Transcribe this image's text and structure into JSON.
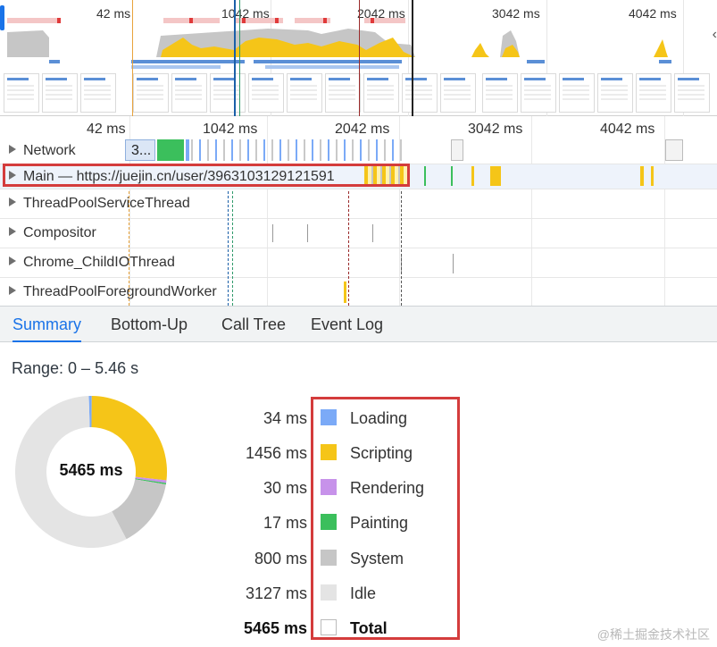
{
  "overview": {
    "ticks": [
      "42 ms",
      "1042 ms",
      "2042 ms",
      "3042 ms",
      "4042 ms"
    ],
    "right_handle_icon": "chevron-left-icon"
  },
  "timeline": {
    "ticks": [
      "42 ms",
      "1042 ms",
      "2042 ms",
      "3042 ms",
      "4042 ms"
    ],
    "network_block_label": "3...",
    "tracks": [
      {
        "label": "Network"
      },
      {
        "label": "Main — https://juejin.cn/user/3963103129121591"
      },
      {
        "label": "ThreadPoolServiceThread"
      },
      {
        "label": "Compositor"
      },
      {
        "label": "Chrome_ChildIOThread"
      },
      {
        "label": "ThreadPoolForegroundWorker"
      }
    ]
  },
  "tabs": [
    {
      "label": "Summary",
      "active": true
    },
    {
      "label": "Bottom-Up",
      "active": false
    },
    {
      "label": "Call Tree",
      "active": false
    },
    {
      "label": "Event Log",
      "active": false
    }
  ],
  "summary": {
    "range": "Range: 0 – 5.46 s",
    "total_label": "5465 ms",
    "categories": [
      {
        "value": "34 ms",
        "name": "Loading",
        "ms": 34,
        "color": "#7baaf7"
      },
      {
        "value": "1456 ms",
        "name": "Scripting",
        "ms": 1456,
        "color": "#f5c518"
      },
      {
        "value": "30 ms",
        "name": "Rendering",
        "ms": 30,
        "color": "#c792ea"
      },
      {
        "value": "17 ms",
        "name": "Painting",
        "ms": 17,
        "color": "#3bbf5c"
      },
      {
        "value": "800 ms",
        "name": "System",
        "ms": 800,
        "color": "#c6c6c6"
      },
      {
        "value": "3127 ms",
        "name": "Idle",
        "ms": 3127,
        "color": "#e4e4e4"
      },
      {
        "value": "5465 ms",
        "name": "Total",
        "ms": 5465,
        "color": "#ffffff"
      }
    ]
  },
  "watermark": "@稀土掘金技术社区"
}
